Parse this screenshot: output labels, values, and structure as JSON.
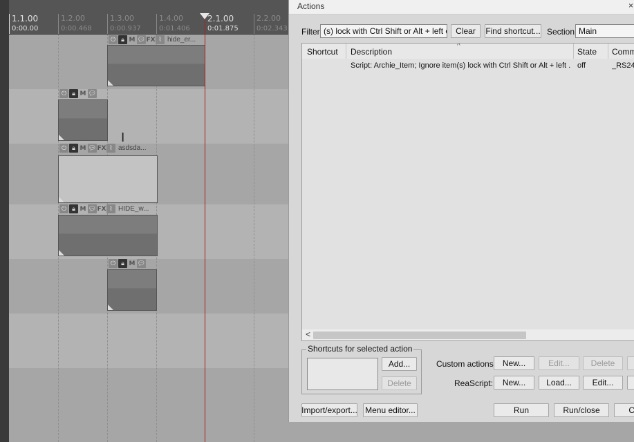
{
  "ruler": {
    "marks": [
      {
        "measure": "1.1.00",
        "time": "0:00.00",
        "major": true
      },
      {
        "measure": "1.2.00",
        "time": "0:00.468",
        "major": false
      },
      {
        "measure": "1.3.00",
        "time": "0:00.937",
        "major": false
      },
      {
        "measure": "1.4.00",
        "time": "0:01.406",
        "major": false
      },
      {
        "measure": "2.1.00",
        "time": "0:01.875",
        "major": true
      },
      {
        "measure": "2.2.00",
        "time": "0:02.343",
        "major": false
      }
    ]
  },
  "items": [
    {
      "name": "hide_er...",
      "buttons": [
        "power",
        "lock",
        "M",
        "speech",
        "FX",
        "env"
      ]
    },
    {
      "name": "",
      "buttons": [
        "power",
        "lock",
        "M",
        "speech"
      ]
    },
    {
      "name": "asdsda...",
      "buttons": [
        "power",
        "lock",
        "M",
        "speech",
        "FX",
        "env"
      ]
    },
    {
      "name": "HIDE_w...",
      "buttons": [
        "power",
        "lock",
        "M",
        "speech",
        "FX",
        "env"
      ]
    },
    {
      "name": "",
      "buttons": [
        "power",
        "lock",
        "M",
        "speech"
      ]
    }
  ],
  "item_labels": {
    "mute": "M",
    "fx": "FX"
  },
  "cursor_glyph": "I",
  "actions_window": {
    "title": "Actions",
    "close_glyph": "×",
    "filter_label": "Filter:",
    "filter_value": "(s) lock with Ctrl Shift or Alt + left click",
    "clear_button": "Clear",
    "find_shortcut_button": "Find shortcut...",
    "section_label": "Section:",
    "section_value": "Main",
    "columns": {
      "shortcut": "Shortcut",
      "description": "Description",
      "state": "State",
      "command": "Comma"
    },
    "sort_glyph": "^",
    "rows": [
      {
        "shortcut": "",
        "description": "Script: Archie_Item;  Ignore item(s) lock with Ctrl Shift or Alt + left  ...",
        "state": "off",
        "command": "_RS24"
      }
    ],
    "scroll_left_glyph": "<",
    "shortcuts_group_title": "Shortcuts for selected action",
    "add_button": "Add...",
    "delete_button": "Delete",
    "custom_actions_label": "Custom actions:",
    "custom_new": "New...",
    "custom_edit": "Edit...",
    "custom_delete": "Delete",
    "reascript_label": "ReaScript:",
    "reascript_new": "New...",
    "reascript_load": "Load...",
    "reascript_edit": "Edit...",
    "import_export_button": "Import/export...",
    "menu_editor_button": "Menu editor...",
    "run_button": "Run",
    "run_close_button": "Run/close",
    "close_button_partial": "C"
  },
  "colors": {
    "playhead": "#b01818",
    "ruler_bg": "#555555",
    "window_bg": "#d7d7d7"
  }
}
